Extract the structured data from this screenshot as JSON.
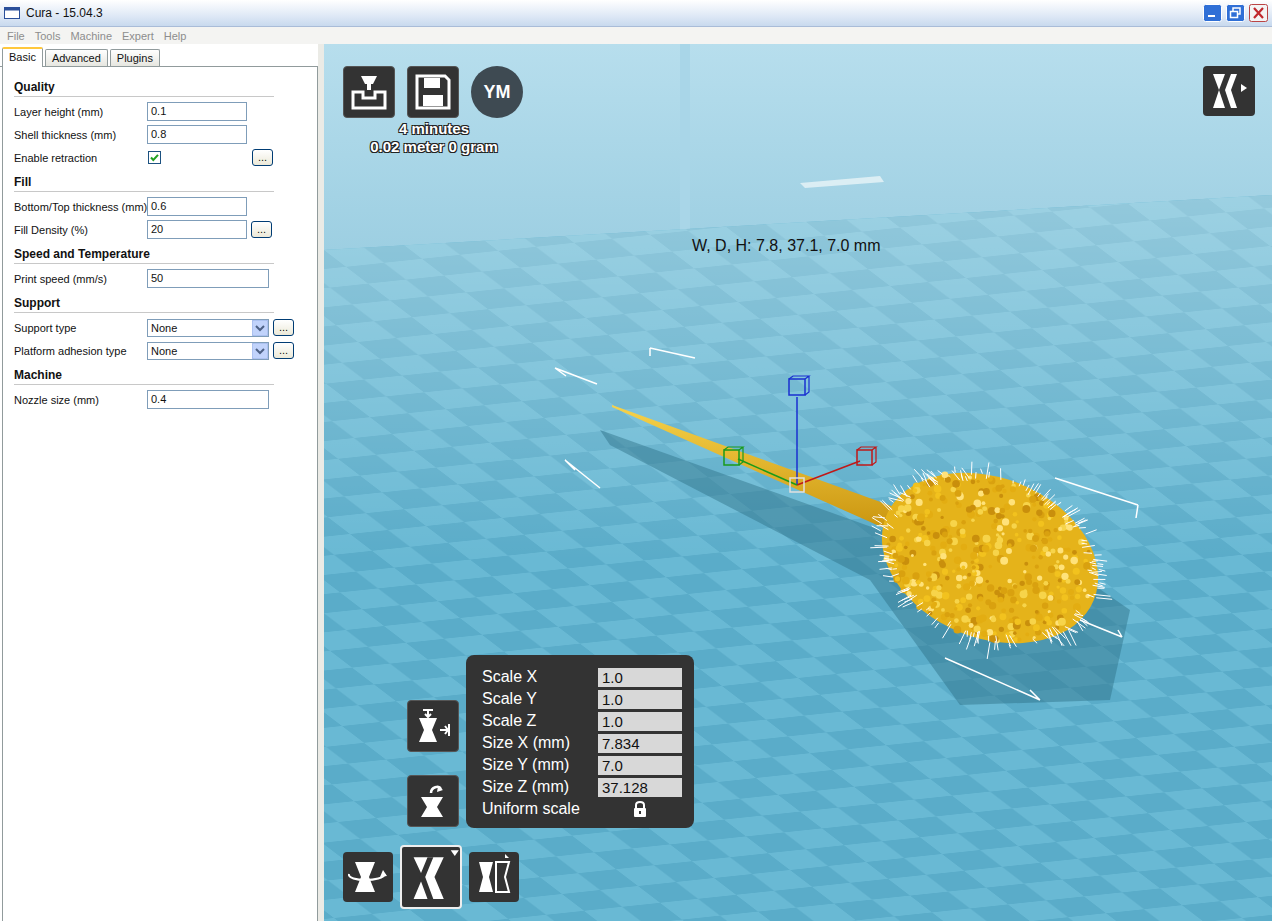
{
  "window": {
    "title": "Cura - 15.04.3"
  },
  "menu": [
    {
      "label": "File",
      "disabled": true
    },
    {
      "label": "Tools",
      "disabled": true
    },
    {
      "label": "Machine",
      "disabled": true
    },
    {
      "label": "Expert",
      "disabled": true
    },
    {
      "label": "Help",
      "disabled": true
    }
  ],
  "tabs": [
    {
      "label": "Basic",
      "selected": true
    },
    {
      "label": "Advanced",
      "selected": false
    },
    {
      "label": "Plugins",
      "selected": false
    }
  ],
  "sections": [
    {
      "title": "Quality",
      "fields": [
        {
          "label": "Layer height (mm)",
          "kind": "input",
          "value": "0.1",
          "button": ""
        },
        {
          "label": "Shell thickness (mm)",
          "kind": "input",
          "value": "0.8",
          "button": ""
        },
        {
          "label": "Enable retraction",
          "kind": "checkbox",
          "checked": true,
          "button": "..."
        }
      ]
    },
    {
      "title": "Fill",
      "fields": [
        {
          "label": "Bottom/Top thickness (mm)",
          "kind": "input",
          "value": "0.6",
          "button": ""
        },
        {
          "label": "Fill Density (%)",
          "kind": "input",
          "value": "20",
          "button": "..."
        }
      ]
    },
    {
      "title": "Speed and Temperature",
      "fields": [
        {
          "label": "Print speed (mm/s)",
          "kind": "wide-input",
          "value": "50",
          "button": ""
        }
      ]
    },
    {
      "title": "Support",
      "fields": [
        {
          "label": "Support type",
          "kind": "select",
          "value": "None",
          "button": "..."
        },
        {
          "label": "Platform adhesion type",
          "kind": "select",
          "value": "None",
          "button": "..."
        }
      ]
    },
    {
      "title": "Machine",
      "fields": [
        {
          "label": "Nozzle size (mm)",
          "kind": "wide-input",
          "value": "0.4",
          "button": ""
        }
      ]
    }
  ],
  "viewport": {
    "print_time": "4 minutes",
    "material": "0.02 meter 0 gram",
    "user_badge": "YM",
    "dimensions": "W, D, H: 7.8, 37.1, 7.0 mm"
  },
  "scale_panel": {
    "rows": [
      {
        "label": "Scale X",
        "value": "1.0"
      },
      {
        "label": "Scale Y",
        "value": "1.0"
      },
      {
        "label": "Scale Z",
        "value": "1.0"
      },
      {
        "label": "Size X (mm)",
        "value": "7.834"
      },
      {
        "label": "Size Y (mm)",
        "value": "7.0"
      },
      {
        "label": "Size Z (mm)",
        "value": "37.128"
      }
    ],
    "uniform_scale": {
      "label": "Uniform scale",
      "locked": true
    }
  },
  "tools": [
    {
      "kind": "rotate",
      "selected": false
    },
    {
      "kind": "scale",
      "selected": true
    },
    {
      "kind": "mirror",
      "selected": false
    }
  ]
}
